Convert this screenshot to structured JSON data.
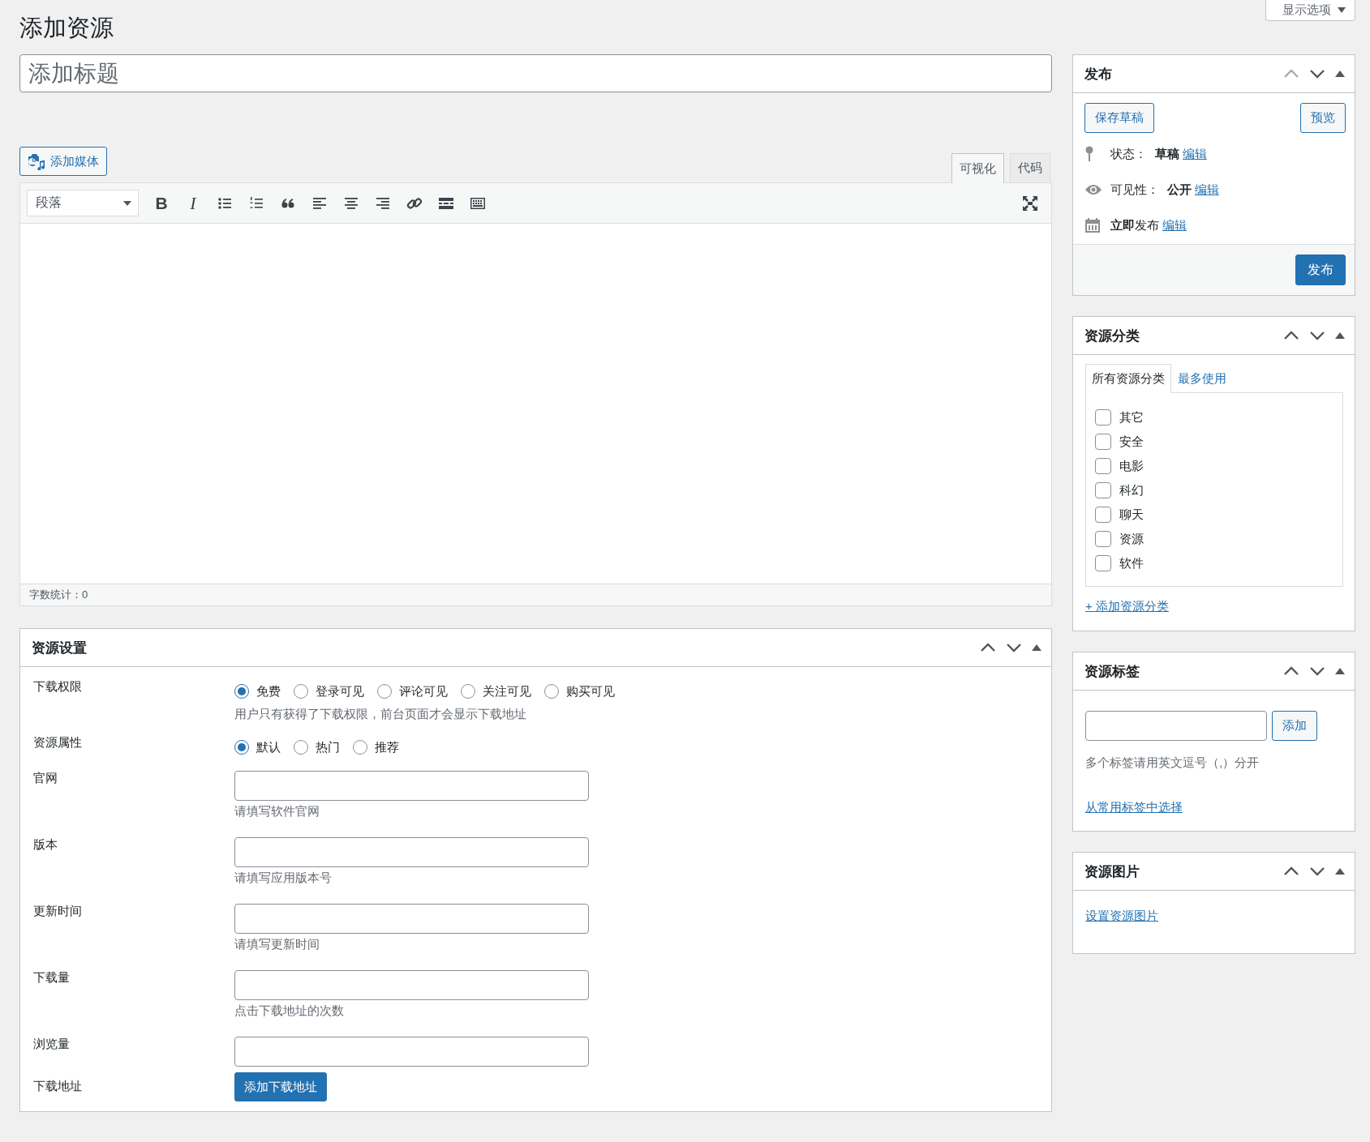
{
  "page_title": "添加资源",
  "screen_options": {
    "label": "显示选项"
  },
  "title_field": {
    "placeholder": "添加标题"
  },
  "editor": {
    "add_media": "添加媒体",
    "tabs": [
      {
        "label": "可视化",
        "selected": true
      },
      {
        "label": "代码",
        "selected": false
      }
    ],
    "format_select": "段落",
    "toolbar": [
      {
        "kind": "bold",
        "text": "B"
      },
      {
        "kind": "italic",
        "text": "I"
      },
      {
        "kind": "bullets"
      },
      {
        "kind": "numbers"
      },
      {
        "kind": "quote"
      },
      {
        "kind": "align-left"
      },
      {
        "kind": "align-center"
      },
      {
        "kind": "align-right"
      },
      {
        "kind": "link"
      },
      {
        "kind": "more"
      },
      {
        "kind": "kitchen-sink"
      }
    ],
    "word_count": "字数统计：0"
  },
  "settings_box": {
    "title": "资源设置",
    "up_disabled": false,
    "rows": [
      {
        "kind": "radio",
        "label": "下载权限",
        "options": [
          {
            "label": "免费",
            "selected": true
          },
          {
            "label": "登录可见",
            "selected": false
          },
          {
            "label": "评论可见",
            "selected": false
          },
          {
            "label": "关注可见",
            "selected": false
          },
          {
            "label": "购买可见",
            "selected": false
          }
        ],
        "description": "用户只有获得了下载权限，前台页面才会显示下载地址"
      },
      {
        "kind": "radio",
        "label": "资源属性",
        "options": [
          {
            "label": "默认",
            "selected": true
          },
          {
            "label": "热门",
            "selected": false
          },
          {
            "label": "推荐",
            "selected": false
          }
        ]
      },
      {
        "kind": "text",
        "label": "官网",
        "description": "请填写软件官网"
      },
      {
        "kind": "text",
        "label": "版本",
        "description": "请填写应用版本号"
      },
      {
        "kind": "text",
        "label": "更新时间",
        "description": "请填写更新时间"
      },
      {
        "kind": "text",
        "label": "下载量",
        "description": "点击下载地址的次数"
      },
      {
        "kind": "text",
        "label": "浏览量"
      },
      {
        "kind": "button",
        "label": "下载地址",
        "button": "添加下载地址"
      }
    ]
  },
  "publish_box": {
    "title": "发布",
    "up_disabled": true,
    "save_draft": "保存草稿",
    "preview": "预览",
    "meta": [
      {
        "kind": "status",
        "label": "状态：",
        "value": "草稿",
        "link": "编辑"
      },
      {
        "kind": "visibility",
        "label": "可见性：",
        "value": "公开",
        "link": "编辑"
      },
      {
        "kind": "schedule",
        "label": "**立即**发布",
        "link": "编辑"
      }
    ],
    "publish": "发布"
  },
  "category_box": {
    "title": "资源分类",
    "up_disabled": false,
    "tabs": [
      {
        "label": "所有资源分类",
        "selected": true
      },
      {
        "label": "最多使用",
        "selected": false
      }
    ],
    "items": [
      {
        "label": "其它",
        "checked": false
      },
      {
        "label": "安全",
        "checked": false
      },
      {
        "label": "电影",
        "checked": false
      },
      {
        "label": "科幻",
        "checked": false
      },
      {
        "label": "聊天",
        "checked": false
      },
      {
        "label": "资源",
        "checked": false
      },
      {
        "label": "软件",
        "checked": false
      }
    ],
    "add_link": "+ 添加资源分类"
  },
  "tags_box": {
    "title": "资源标签",
    "up_disabled": false,
    "add_button": "添加",
    "hint": "多个标签请用英文逗号（,）分开",
    "choose_link": "从常用标签中选择"
  },
  "image_box": {
    "title": "资源图片",
    "up_disabled": false,
    "set_link": "设置资源图片"
  }
}
